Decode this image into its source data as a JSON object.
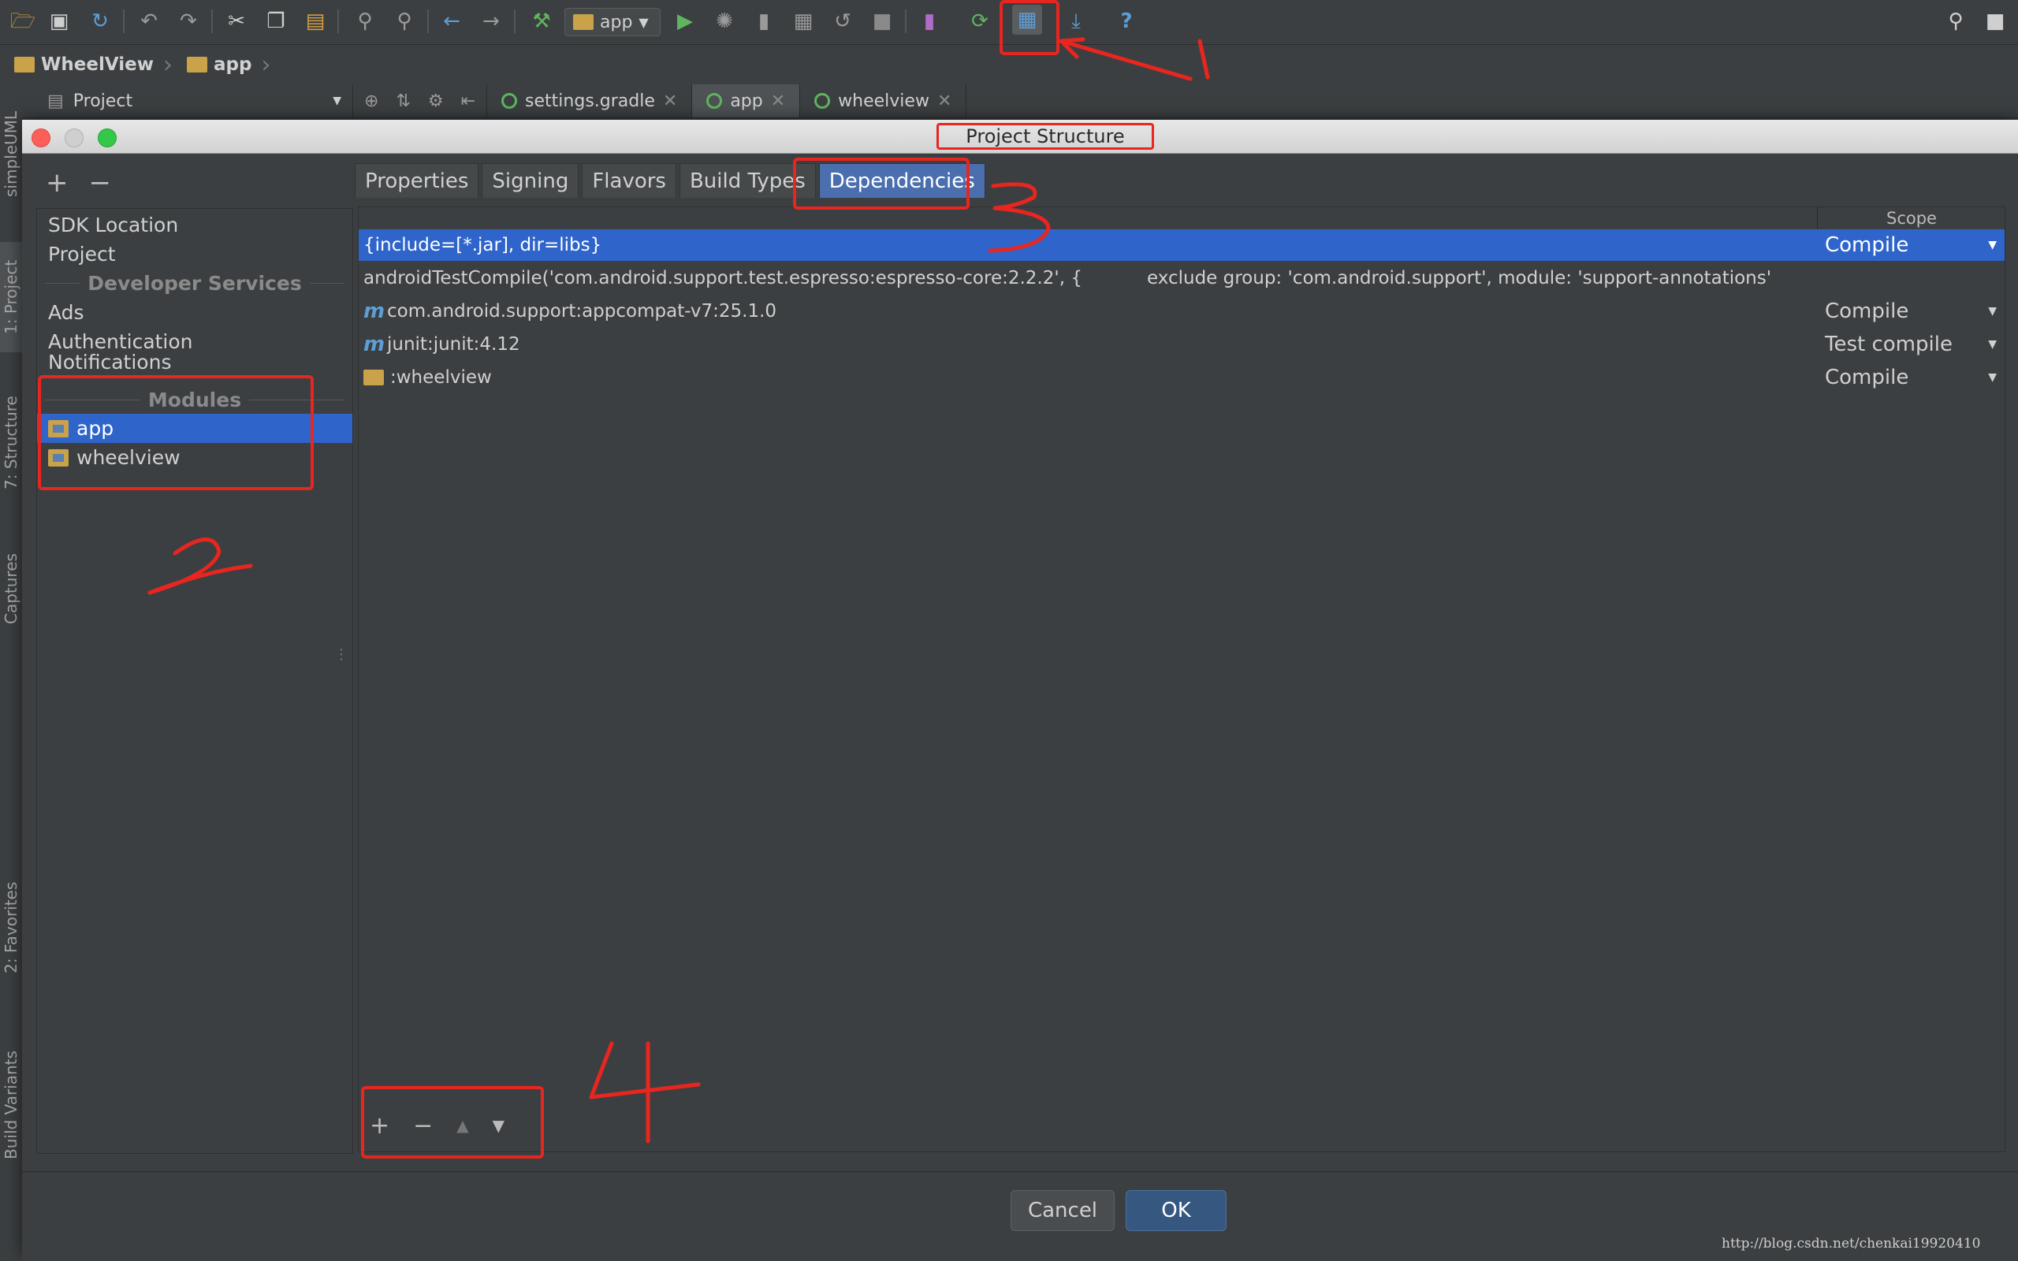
{
  "toolbar": {
    "run_config": "app",
    "icons": [
      "open-folder-icon",
      "save-icon",
      "sync-icon",
      "undo-icon",
      "redo-icon",
      "cut-icon",
      "copy-icon",
      "paste-icon",
      "find-icon",
      "replace-icon",
      "back-icon",
      "forward-icon",
      "build-hammer-icon",
      "run-icon",
      "debug-icon",
      "profile-icon",
      "attach-debugger-icon",
      "apply-changes-icon",
      "stop-icon",
      "avd-manager-icon",
      "gradle-sync-icon",
      "project-structure-icon",
      "sdk-manager-icon",
      "help-icon",
      "search-icon",
      "user-icon"
    ]
  },
  "breadcrumb": {
    "root": "WheelView",
    "module": "app"
  },
  "left_strip": {
    "labels": [
      "simpleUML",
      "1: Project",
      "7: Structure",
      "Captures",
      "2: Favorites",
      "Build Variants"
    ]
  },
  "project_pane": {
    "label": "Project"
  },
  "editor_tabs": [
    {
      "label": "settings.gradle"
    },
    {
      "label": "app"
    },
    {
      "label": "wheelview"
    }
  ],
  "dialog": {
    "title": "Project Structure",
    "left_list": {
      "items": [
        "SDK Location",
        "Project"
      ],
      "developer_services_header": "Developer Services",
      "services": [
        "Ads",
        "Authentication",
        "Notifications"
      ],
      "modules_header": "Modules",
      "modules": [
        "app",
        "wheelview"
      ],
      "selected_module": "app"
    },
    "tabs": [
      "Properties",
      "Signing",
      "Flavors",
      "Build Types",
      "Dependencies"
    ],
    "active_tab": "Dependencies",
    "table": {
      "scope_header": "Scope",
      "rows": [
        {
          "name": "{include=[*.jar], dir=libs}",
          "scope": "Compile",
          "selected": true
        },
        {
          "name": "androidTestCompile('com.android.support.test.espresso:espresso-core:2.2.2', {",
          "extra": "exclude group: 'com.android.support', module: 'support-annotations'",
          "scope": ""
        },
        {
          "name": "com.android.support:appcompat-v7:25.1.0",
          "scope": "Compile",
          "icon": "maven-icon"
        },
        {
          "name": "junit:junit:4.12",
          "scope": "Test compile",
          "icon": "maven-icon"
        },
        {
          "name": ":wheelview",
          "scope": "Compile",
          "icon": "module-folder-icon"
        }
      ]
    },
    "buttons": {
      "cancel": "Cancel",
      "ok": "OK"
    }
  },
  "annotations": {
    "marks": [
      "1",
      "2",
      "3",
      "4"
    ],
    "color": "#e8261f"
  },
  "watermark": "http://blog.csdn.net/chenkai19920410",
  "colors": {
    "selection": "#2f65ca",
    "ok_button": "#365880",
    "background": "#3c3f41"
  }
}
